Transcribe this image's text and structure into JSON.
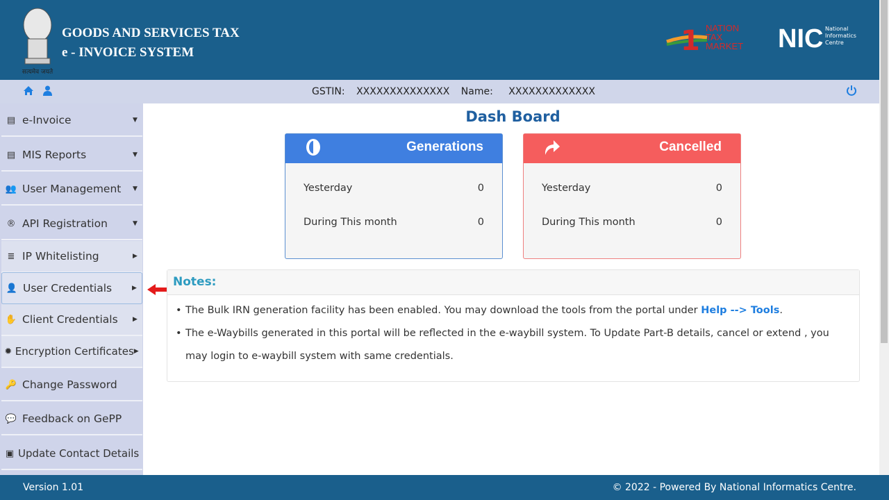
{
  "header": {
    "title_line1": "GOODS AND SERVICES TAX",
    "title_line2": "e - INVOICE SYSTEM",
    "emblem_motto": "सत्यमेव जयते",
    "logo_ntm": "1 NATION TAX MARKET GST",
    "logo_nic": "NIC National Informatics Centre"
  },
  "subbar": {
    "gstin_label": "GSTIN:",
    "gstin_value": "XXXXXXXXXXXXXX",
    "name_label": "Name:",
    "name_value": "XXXXXXXXXXXXX",
    "icons": [
      "home-icon",
      "user-icon",
      "power-icon"
    ]
  },
  "sidebar": {
    "items": [
      {
        "label": "e-Invoice",
        "icon": "file-icon",
        "caret": "down"
      },
      {
        "label": "MIS Reports",
        "icon": "list-icon",
        "caret": "down"
      },
      {
        "label": "User Management",
        "icon": "users-icon",
        "caret": "down"
      },
      {
        "label": "API Registration",
        "icon": "registered-icon",
        "caret": "down"
      },
      {
        "label": "IP Whitelisting",
        "icon": "server-icon",
        "caret": "right"
      },
      {
        "label": "User Credentials",
        "icon": "user-cog-icon",
        "caret": "right"
      },
      {
        "label": "Client Credentials",
        "icon": "handshake-icon",
        "caret": "right"
      },
      {
        "label": "Encryption Certificates",
        "icon": "certificate-icon",
        "caret": "right"
      },
      {
        "label": "Change Password",
        "icon": "key-icon",
        "caret": ""
      },
      {
        "label": "Feedback on GePP",
        "icon": "comments-icon",
        "caret": ""
      },
      {
        "label": "Update Contact Details",
        "icon": "id-card-icon",
        "caret": ""
      }
    ]
  },
  "main": {
    "title": "Dash Board",
    "cards": [
      {
        "title": "Generations",
        "color": "#3f7fe0",
        "rows": [
          {
            "label": "Yesterday",
            "value": "0"
          },
          {
            "label": "During This month",
            "value": "0"
          }
        ]
      },
      {
        "title": "Cancelled",
        "color": "#f55d5d",
        "rows": [
          {
            "label": "Yesterday",
            "value": "0"
          },
          {
            "label": "During This month",
            "value": "0"
          }
        ]
      }
    ],
    "notes": {
      "heading": "Notes:",
      "note1_text": "The Bulk IRN generation facility has been enabled. You may download the tools from the portal under ",
      "note1_link": "Help --> Tools",
      "note1_end": ".",
      "note2_text": "The e-Waybills generated in this portal will be reflected in the e-waybill system. To Update Part-B details, cancel or extend , you may login to e-waybill system with same credentials."
    }
  },
  "footer": {
    "version": "Version 1.01",
    "copyright": "© 2022 - Powered By National Informatics Centre."
  }
}
